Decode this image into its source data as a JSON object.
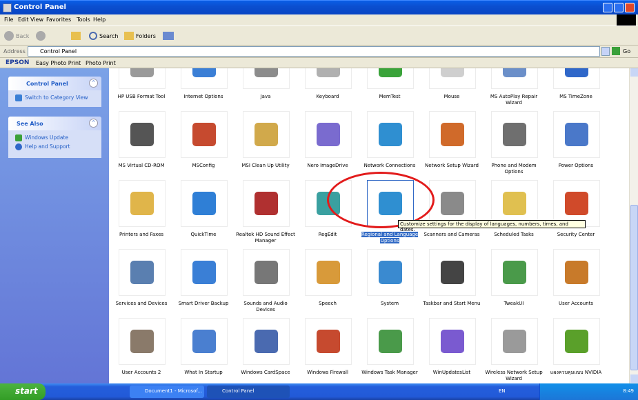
{
  "window": {
    "title": "Control Panel"
  },
  "menu": [
    "File",
    "Edit",
    "View",
    "Favorites",
    "Tools",
    "Help"
  ],
  "toolbar": {
    "back": "Back",
    "search": "Search",
    "folders": "Folders"
  },
  "address": {
    "label": "Address",
    "value": "Control Panel",
    "go": "Go"
  },
  "epson": {
    "brand": "EPSON",
    "easy": "Easy Photo Print",
    "photo": "Photo Print"
  },
  "sidebar": {
    "panel_title": "Control Panel",
    "switch_link": "Switch to Category View",
    "see_also_title": "See Also",
    "see_also": [
      "Windows Update",
      "Help and Support"
    ]
  },
  "items": [
    {
      "label": "HP USB Format Tool",
      "color": "#9a9a9a"
    },
    {
      "label": "Internet Options",
      "color": "#3b7fd6"
    },
    {
      "label": "Java",
      "color": "#8c8c8c"
    },
    {
      "label": "Keyboard",
      "color": "#b0b0b0"
    },
    {
      "label": "MemTest",
      "color": "#3aa33a"
    },
    {
      "label": "Mouse",
      "color": "#cfcfcf"
    },
    {
      "label": "MS AutoPlay Repair Wizard",
      "color": "#6b8fc9"
    },
    {
      "label": "MS TimeZone",
      "color": "#2f67c9"
    },
    {
      "label": "MS Virtual CD-ROM",
      "color": "#555555"
    },
    {
      "label": "MSConfig",
      "color": "#c64a2f"
    },
    {
      "label": "MSI Clean Up Utility",
      "color": "#d1a94b"
    },
    {
      "label": "Nero ImageDrive",
      "color": "#7a6bcf"
    },
    {
      "label": "Network Connections",
      "color": "#2f8fd1"
    },
    {
      "label": "Network Setup Wizard",
      "color": "#d06a2a"
    },
    {
      "label": "Phone and Modem Options",
      "color": "#6f6f6f"
    },
    {
      "label": "Power Options",
      "color": "#4a78c9"
    },
    {
      "label": "Printers and Faxes",
      "color": "#e0b54a"
    },
    {
      "label": "QuickTime",
      "color": "#2f7fd6"
    },
    {
      "label": "Realtek HD Sound Effect Manager",
      "color": "#b03030"
    },
    {
      "label": "RegEdit",
      "color": "#3aa0a0"
    },
    {
      "label": "Regional and Language Options",
      "color": "#2f8fd1"
    },
    {
      "label": "Scanners and Cameras",
      "color": "#8a8a8a"
    },
    {
      "label": "Scheduled Tasks",
      "color": "#e0c050"
    },
    {
      "label": "Security Center",
      "color": "#d04a2a"
    },
    {
      "label": "Services and Devices",
      "color": "#5a7fb0"
    },
    {
      "label": "Smart Driver Backup",
      "color": "#3a7fd6"
    },
    {
      "label": "Sounds and Audio Devices",
      "color": "#777777"
    },
    {
      "label": "Speech",
      "color": "#d89a3a"
    },
    {
      "label": "System",
      "color": "#3a8ad0"
    },
    {
      "label": "Taskbar and Start Menu",
      "color": "#444444"
    },
    {
      "label": "TweakUI",
      "color": "#4a9a4a"
    },
    {
      "label": "User Accounts",
      "color": "#c87a2a"
    },
    {
      "label": "User Accounts 2",
      "color": "#8a7a6a"
    },
    {
      "label": "What In Startup",
      "color": "#4a7fd0"
    },
    {
      "label": "Windows CardSpace",
      "color": "#4a6ab0"
    },
    {
      "label": "Windows Firewall",
      "color": "#c64a2f"
    },
    {
      "label": "Windows Task Manager",
      "color": "#4a9a4a"
    },
    {
      "label": "WinUpdatesList",
      "color": "#7a5ad0"
    },
    {
      "label": "Wireless Network Setup Wizard",
      "color": "#9a9a9a"
    },
    {
      "label": "แผงควบคุมแบบ NVIDIA",
      "color": "#5aa02a"
    }
  ],
  "tooltip": "Customize settings for the display of languages, numbers, times, and dates.",
  "taskbar": {
    "start": "start",
    "tasks": [
      "Document1 - Microsof...",
      "Control Panel"
    ],
    "lang": "EN",
    "clock": "8:49"
  }
}
